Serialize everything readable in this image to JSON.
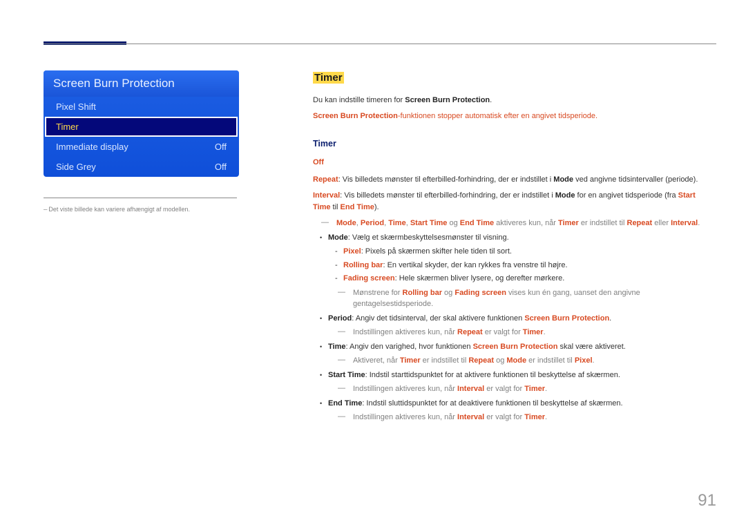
{
  "menu": {
    "title": "Screen Burn Protection",
    "items": [
      {
        "label": "Pixel Shift",
        "value": ""
      },
      {
        "label": "Timer",
        "value": "",
        "selected": true
      },
      {
        "label": "Immediate display",
        "value": "Off"
      },
      {
        "label": "Side Grey",
        "value": "Off"
      }
    ]
  },
  "note": "Det viste billede kan variere afhængigt af modellen.",
  "heading": "Timer",
  "intro": {
    "line1_prefix": "Du kan indstille timeren for ",
    "line1_bold": "Screen Burn Protection",
    "line1_suffix": ".",
    "line2_bold": "Screen Burn Protection",
    "line2_rest": "-funktionen stopper automatisk efter en angivet tidsperiode."
  },
  "subheading": "Timer",
  "suboff": "Off",
  "repeat": {
    "label": "Repeat",
    "txt1": ": Vis billedets mønster til efterbilled-forhindring, der er indstillet i ",
    "mode": "Mode",
    "txt2": " ved angivne tidsintervaller (periode)."
  },
  "interval": {
    "label": "Interval",
    "txt1": ": Vis billedets mønster til efterbilled-forhindring, der er indstillet i ",
    "mode": "Mode",
    "txt2": " for en angivet tidsperiode (fra ",
    "start": "Start Time",
    "txt3": " til ",
    "end": "End Time",
    "txt4": ")."
  },
  "greynote1": {
    "mode": "Mode",
    "period": "Period",
    "time": "Time",
    "start": "Start Time",
    "end": "End Time",
    "og1": " og ",
    "txt1": " aktiveres kun, når ",
    "timer": "Timer",
    "txt2": " er indstillet til ",
    "repeat": "Repeat",
    "eller": " eller ",
    "interval": "Interval",
    "dot": "."
  },
  "mode_line": {
    "mode": "Mode",
    "txt": ": Vælg et skærmbeskyttelsesmønster til visning."
  },
  "pixel_line": {
    "pixel": "Pixel",
    "txt": ": Pixels på skærmen skifter hele tiden til sort."
  },
  "rolling_line": {
    "rb": "Rolling bar",
    "txt": ": En vertikal skyder, der kan rykkes fra venstre til højre."
  },
  "fading_line": {
    "fs": "Fading screen",
    "txt": ": Hele skærmen bliver lysere, og derefter mørkere."
  },
  "greynote2": {
    "txt1": "Mønstrene for ",
    "rb": "Rolling bar",
    "og": " og ",
    "fs": "Fading screen",
    "txt2": " vises kun én gang, uanset den angivne gentagelsestidsperiode."
  },
  "period": {
    "label": "Period",
    "txt1": ": Angiv det tidsinterval, der skal aktivere funktionen ",
    "sbp": "Screen Burn Protection",
    "txt2": "."
  },
  "greynote3": {
    "txt1": "Indstillingen aktiveres kun, når ",
    "repeat": "Repeat",
    "txt2": " er valgt for ",
    "timer": "Timer",
    "dot": "."
  },
  "time": {
    "label": "Time",
    "txt1": ": Angiv den varighed, hvor funktionen ",
    "sbp": "Screen Burn Protection",
    "txt2": " skal være aktiveret."
  },
  "greynote4": {
    "txt1": "Aktiveret, når ",
    "timer": "Timer",
    "txt2": " er indstillet til ",
    "repeat": "Repeat",
    "og": " og ",
    "mode": "Mode",
    "txt3": " er indstillet til ",
    "pixel": "Pixel",
    "dot": "."
  },
  "starttime": {
    "label": "Start Time",
    "txt": ": Indstil starttidspunktet for at aktivere funktionen til beskyttelse af skærmen."
  },
  "greynote5": {
    "txt1": "Indstillingen aktiveres kun, når ",
    "interval": "Interval",
    "txt2": " er valgt for ",
    "timer": "Timer",
    "dot": "."
  },
  "endtime": {
    "label": "End Time",
    "txt": ": Indstil sluttidspunktet for at deaktivere funktionen til beskyttelse af skærmen."
  },
  "greynote6": {
    "txt1": "Indstillingen aktiveres kun, når ",
    "interval": "Interval",
    "txt2": " er valgt for ",
    "timer": "Timer",
    "dot": "."
  },
  "page_number": "91"
}
